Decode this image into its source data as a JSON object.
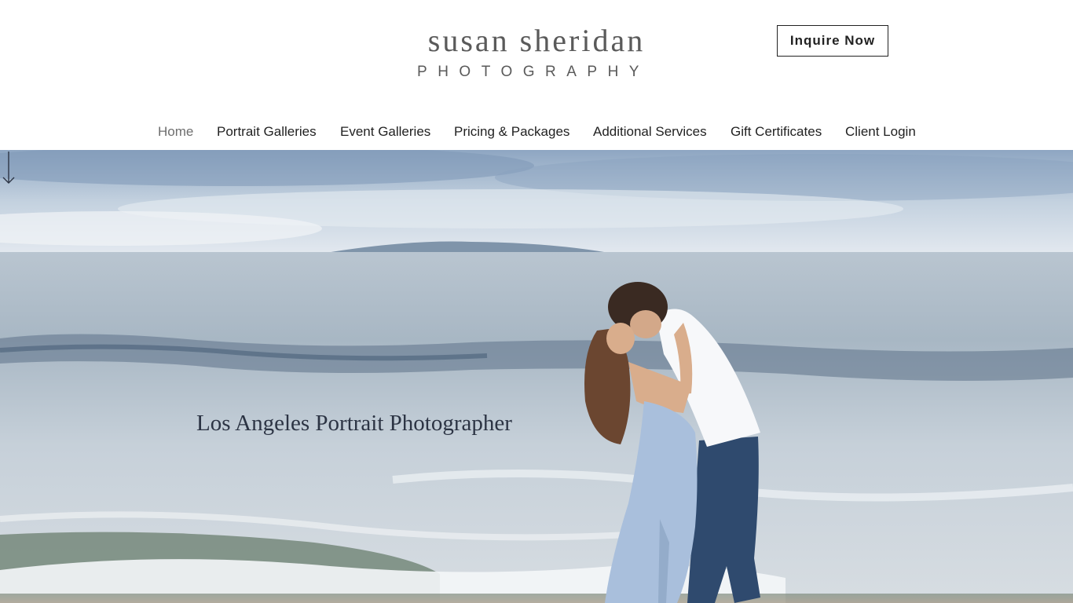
{
  "brand": {
    "name": "susan sheridan",
    "tagline": "PHOTOGRAPHY"
  },
  "header": {
    "inquire_label": "Inquire Now"
  },
  "nav": {
    "items": [
      {
        "label": "Home",
        "active": true
      },
      {
        "label": "Portrait Galleries",
        "active": false
      },
      {
        "label": "Event Galleries",
        "active": false
      },
      {
        "label": "Pricing & Packages",
        "active": false
      },
      {
        "label": "Additional Services",
        "active": false
      },
      {
        "label": "Gift Certificates",
        "active": false
      },
      {
        "label": "Client Login",
        "active": false
      }
    ]
  },
  "hero": {
    "title": "Los Angeles Portrait Photographer",
    "scroll_icon": "arrow-down-icon",
    "image": "couple-kissing-at-beach-photo"
  },
  "colors": {
    "text_dark": "#222222",
    "brand_gray": "#5a5a5a",
    "nav_active": "#6e6e6e",
    "hero_title": "#2c3444"
  }
}
